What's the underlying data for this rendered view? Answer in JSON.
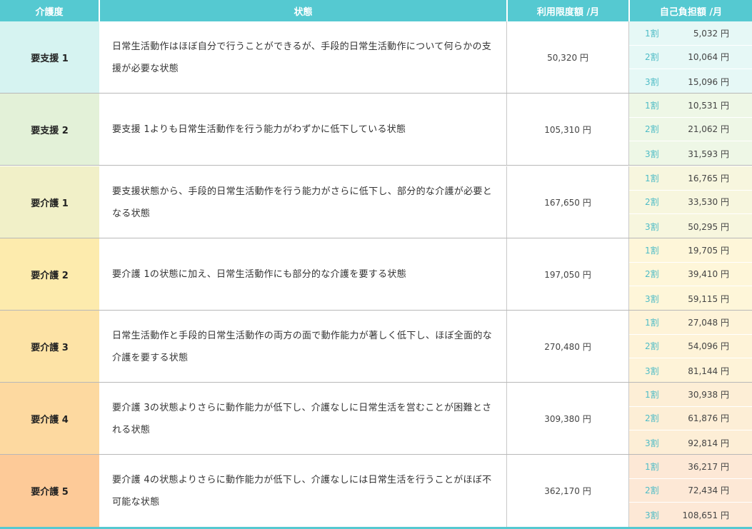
{
  "headers": {
    "level": "介護度",
    "state": "状態",
    "limit": "利用限度額 /月",
    "copay": "自己負担額 /月"
  },
  "rates": [
    "1割",
    "2割",
    "3割"
  ],
  "rows": [
    {
      "level": "要支援 1",
      "state": "日常生活動作はほぼ自分で行うことができるが、手段的日常生活動作について何らかの支援が必要な状態",
      "limit": "50,320 円",
      "copays": [
        "5,032 円",
        "10,064 円",
        "15,096 円"
      ],
      "level_color": "#d6f3f1",
      "copay_color": "#e6f8f6"
    },
    {
      "level": "要支援 2",
      "state": "要支援 1よりも日常生活動作を行う能力がわずかに低下している状態",
      "limit": "105,310 円",
      "copays": [
        "10,531 円",
        "21,062 円",
        "31,593 円"
      ],
      "level_color": "#e3f1d8",
      "copay_color": "#eef7e6"
    },
    {
      "level": "要介護 1",
      "state": "要支援状態から、手段的日常生活動作を行う能力がさらに低下し、部分的な介護が必要となる状態",
      "limit": "167,650 円",
      "copays": [
        "16,765 円",
        "33,530 円",
        "50,295 円"
      ],
      "level_color": "#f1f0c8",
      "copay_color": "#f7f6de"
    },
    {
      "level": "要介護 2",
      "state": "要介護 1の状態に加え、日常生活動作にも部分的な介護を要する状態",
      "limit": "197,050 円",
      "copays": [
        "19,705 円",
        "39,410 円",
        "59,115 円"
      ],
      "level_color": "#fdebad",
      "copay_color": "#fef6d9"
    },
    {
      "level": "要介護 3",
      "state": "日常生活動作と手段的日常生活動作の両方の面で動作能力が著しく低下し、ほぼ全面的な介護を要する状態",
      "limit": "270,480 円",
      "copays": [
        "27,048 円",
        "54,096 円",
        "81,144 円"
      ],
      "level_color": "#fde3a6",
      "copay_color": "#fef3d8"
    },
    {
      "level": "要介護 4",
      "state": "要介護 3の状態よりさらに動作能力が低下し、介護なしに日常生活を営むことが困難とされる状態",
      "limit": "309,380 円",
      "copays": [
        "30,938 円",
        "61,876 円",
        "92,814 円"
      ],
      "level_color": "#fdd9a0",
      "copay_color": "#fdeed6"
    },
    {
      "level": "要介護 5",
      "state": "要介護 4の状態よりさらに動作能力が低下し、介護なしには日常生活を行うことがほぼ不可能な状態",
      "limit": "362,170 円",
      "copays": [
        "36,217 円",
        "72,434 円",
        "108,651 円"
      ],
      "level_color": "#fdca98",
      "copay_color": "#fde8d6"
    }
  ]
}
